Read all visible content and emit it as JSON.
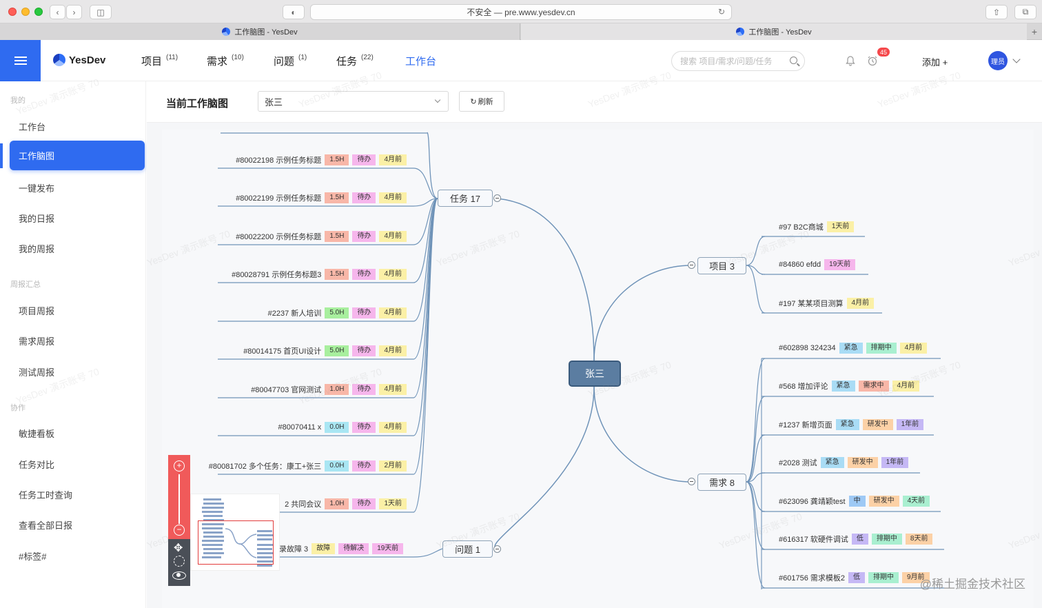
{
  "browser": {
    "address": "不安全 — pre.www.yesdev.cn",
    "tabs": [
      {
        "label": "工作脑图 - YesDev"
      },
      {
        "label": "工作脑图 - YesDev"
      }
    ]
  },
  "app": {
    "logo": "YesDev",
    "nav": [
      {
        "label": "项目",
        "count": "(11)"
      },
      {
        "label": "需求",
        "count": "(10)"
      },
      {
        "label": "问题",
        "count": "(1)"
      },
      {
        "label": "任务",
        "count": "(22)"
      },
      {
        "label": "工作台",
        "count": ""
      }
    ],
    "search_placeholder": "搜索 项目/需求/问题/任务",
    "notification_count": "45",
    "add_label": "添加 +",
    "avatar_label": "理员"
  },
  "sidebar": {
    "groups": [
      {
        "title": "我的",
        "items": [
          "工作台",
          "工作脑图",
          "一键发布",
          "我的日报",
          "我的周报"
        ]
      },
      {
        "title": "周报汇总",
        "items": [
          "项目周报",
          "需求周报",
          "测试周报"
        ]
      },
      {
        "title": "协作",
        "items": [
          "敏捷看板",
          "任务对比",
          "任务工时查询",
          "查看全部日报",
          "#标签#"
        ]
      }
    ],
    "active": "工作脑图"
  },
  "toolbar": {
    "title": "当前工作脑图",
    "select_value": "张三",
    "refresh_label": "刷新"
  },
  "mindmap": {
    "root": "张三",
    "task_node": "任务 17",
    "issue_node": "问题 1",
    "project_node": "项目 3",
    "req_node": "需求 8",
    "tasks": [
      {
        "title": "#80022198 示例任务标题",
        "hours": "1.5H",
        "status": "待办",
        "time": "4月前",
        "hcolor": "#f8b7a8"
      },
      {
        "title": "#80022199 示例任务标题",
        "hours": "1.5H",
        "status": "待办",
        "time": "4月前",
        "hcolor": "#f8b7a8"
      },
      {
        "title": "#80022200 示例任务标题",
        "hours": "1.5H",
        "status": "待办",
        "time": "4月前",
        "hcolor": "#f8b7a8"
      },
      {
        "title": "#80028791 示例任务标题3",
        "hours": "1.5H",
        "status": "待办",
        "time": "4月前",
        "hcolor": "#f8b7a8"
      },
      {
        "title": "#2237 新人培训",
        "hours": "5.0H",
        "status": "待办",
        "time": "4月前",
        "hcolor": "#a8ef9e"
      },
      {
        "title": "#80014175 首页UI设计",
        "hours": "5.0H",
        "status": "待办",
        "time": "4月前",
        "hcolor": "#a8ef9e"
      },
      {
        "title": "#80047703 官网测试",
        "hours": "1.0H",
        "status": "待办",
        "time": "4月前",
        "hcolor": "#f8b7a8"
      },
      {
        "title": "#80070411 x",
        "hours": "0.0H",
        "status": "待办",
        "time": "4月前",
        "hcolor": "#a9e6f3"
      },
      {
        "title": "#80081702 多个任务：康工+张三",
        "hours": "0.0H",
        "status": "待办",
        "time": "2月前",
        "hcolor": "#a9e6f3"
      },
      {
        "title": "#80... 共同会议",
        "hours": "1.0H",
        "status": "待办",
        "time": "1天前",
        "hcolor": "#f8b7a8"
      }
    ],
    "issue": {
      "title": "录故障 3",
      "type": "故障",
      "status": "待解决",
      "time": "19天前"
    },
    "projects": [
      {
        "title": "#97 B2C商城",
        "time": "1天前"
      },
      {
        "title": "#84860 efdd",
        "time": "19天前",
        "pink": true
      },
      {
        "title": "#197 某某项目测算",
        "time": "4月前"
      }
    ],
    "requirements": [
      {
        "title": "#602898 324234",
        "pri": "紧急",
        "status": "排期中",
        "time": "4月前",
        "pcolor": "#a9dcf5",
        "scolor": "#a9efd0",
        "tcolor": "#fbf0a6"
      },
      {
        "title": "#568 增加评论",
        "pri": "紧急",
        "status": "需求中",
        "time": "4月前",
        "pcolor": "#a9dcf5",
        "scolor": "#f8b7a8",
        "tcolor": "#fbf0a6"
      },
      {
        "title": "#1237 新增页面",
        "pri": "紧急",
        "status": "研发中",
        "time": "1年前",
        "pcolor": "#a9dcf5",
        "scolor": "#fcd1a6",
        "tcolor": "#c5b8f5"
      },
      {
        "title": "#2028 测试",
        "pri": "紧急",
        "status": "研发中",
        "time": "1年前",
        "pcolor": "#a9dcf5",
        "scolor": "#fcd1a6",
        "tcolor": "#c5b8f5"
      },
      {
        "title": "#623096 龚靖颖test",
        "pri": "中",
        "status": "研发中",
        "time": "4天前",
        "pcolor": "#9ec9f5",
        "scolor": "#fcd1a6",
        "tcolor": "#a9efd0"
      },
      {
        "title": "#616317 软硬件调试",
        "pri": "低",
        "status": "排期中",
        "time": "8天前",
        "pcolor": "#c5b8f5",
        "scolor": "#a9efd0",
        "tcolor": "#fcd1a6"
      },
      {
        "title": "#601756 需求模板2",
        "pri": "低",
        "status": "排期中",
        "time": "9月前",
        "pcolor": "#c5b8f5",
        "scolor": "#a9efd0",
        "tcolor": "#fcd1a6"
      }
    ]
  },
  "watermark": "YesDev 演示账号 70",
  "credit": "@稀土掘金技术社区"
}
